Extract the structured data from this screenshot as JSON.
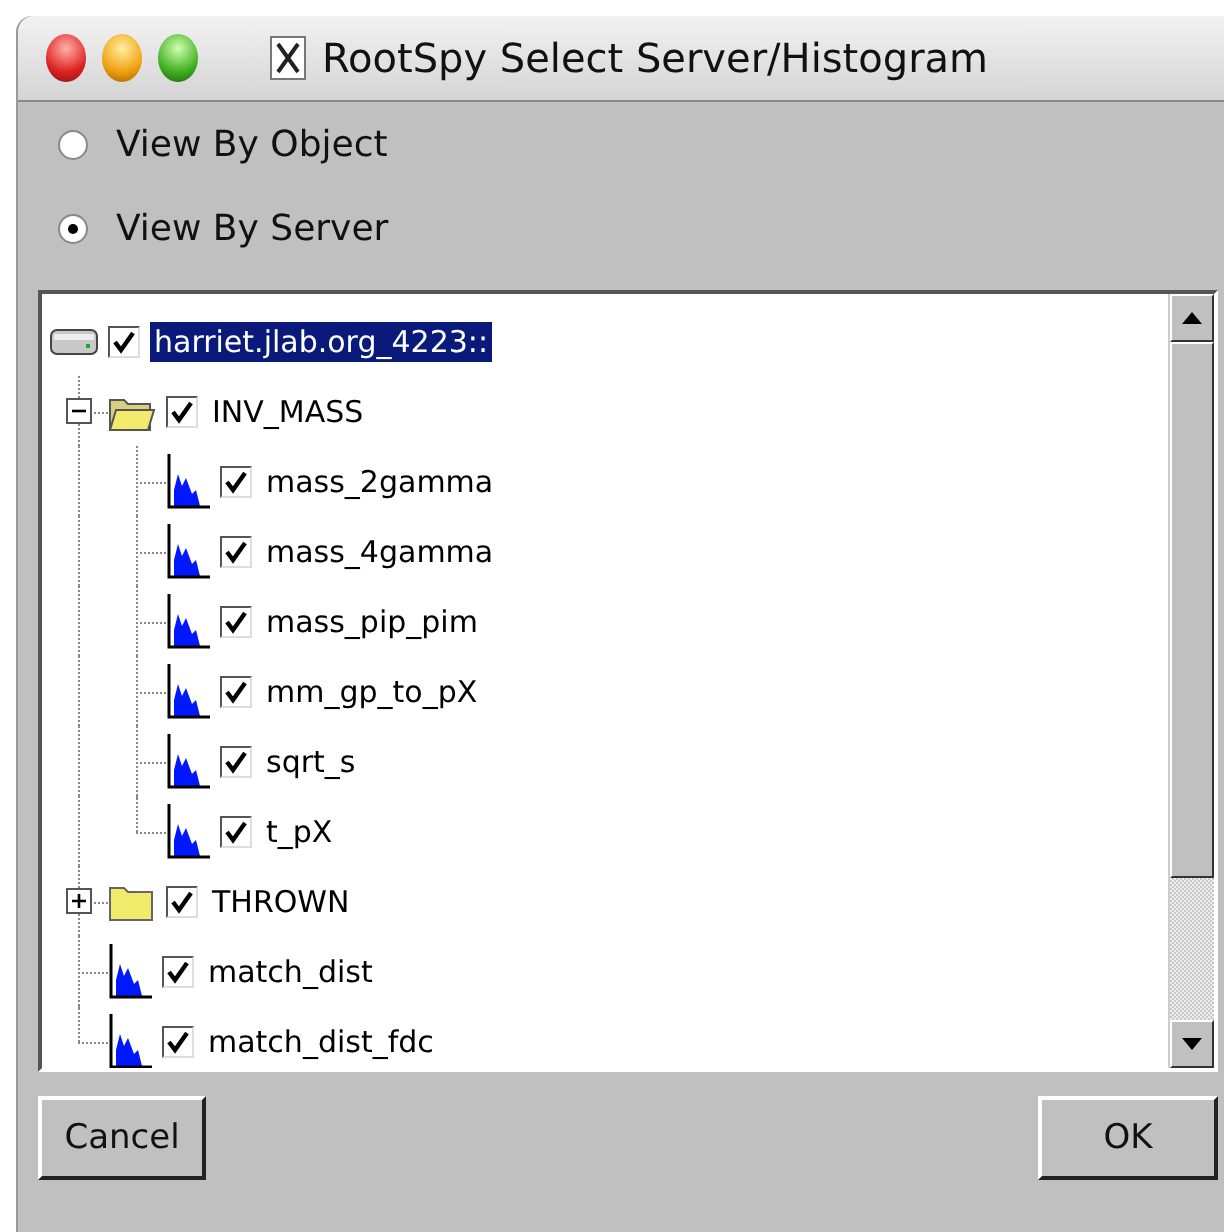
{
  "window": {
    "title": "RootSpy Select Server/Histogram"
  },
  "view_options": [
    {
      "label": "View By Object",
      "selected": false
    },
    {
      "label": "View By Server",
      "selected": true
    }
  ],
  "tree": {
    "items": [
      {
        "kind": "server",
        "label": "harriet.jlab.org_4223::",
        "checked": true,
        "selected": true,
        "children": [
          {
            "kind": "folder",
            "label": "INV_MASS",
            "checked": true,
            "selected": false,
            "expanded": true,
            "children": [
              {
                "kind": "histogram",
                "label": "mass_2gamma",
                "checked": true,
                "selected": false
              },
              {
                "kind": "histogram",
                "label": "mass_4gamma",
                "checked": true,
                "selected": false
              },
              {
                "kind": "histogram",
                "label": "mass_pip_pim",
                "checked": true,
                "selected": false
              },
              {
                "kind": "histogram",
                "label": "mm_gp_to_pX",
                "checked": true,
                "selected": false
              },
              {
                "kind": "histogram",
                "label": "sqrt_s",
                "checked": true,
                "selected": false
              },
              {
                "kind": "histogram",
                "label": "t_pX",
                "checked": true,
                "selected": false
              }
            ]
          },
          {
            "kind": "folder",
            "label": "THROWN",
            "checked": true,
            "selected": false,
            "expanded": false
          },
          {
            "kind": "histogram",
            "label": "match_dist",
            "checked": true,
            "selected": false
          },
          {
            "kind": "histogram",
            "label": "match_dist_fdc",
            "checked": true,
            "selected": false
          }
        ]
      }
    ]
  },
  "buttons": [
    "Cancel",
    "OK"
  ]
}
